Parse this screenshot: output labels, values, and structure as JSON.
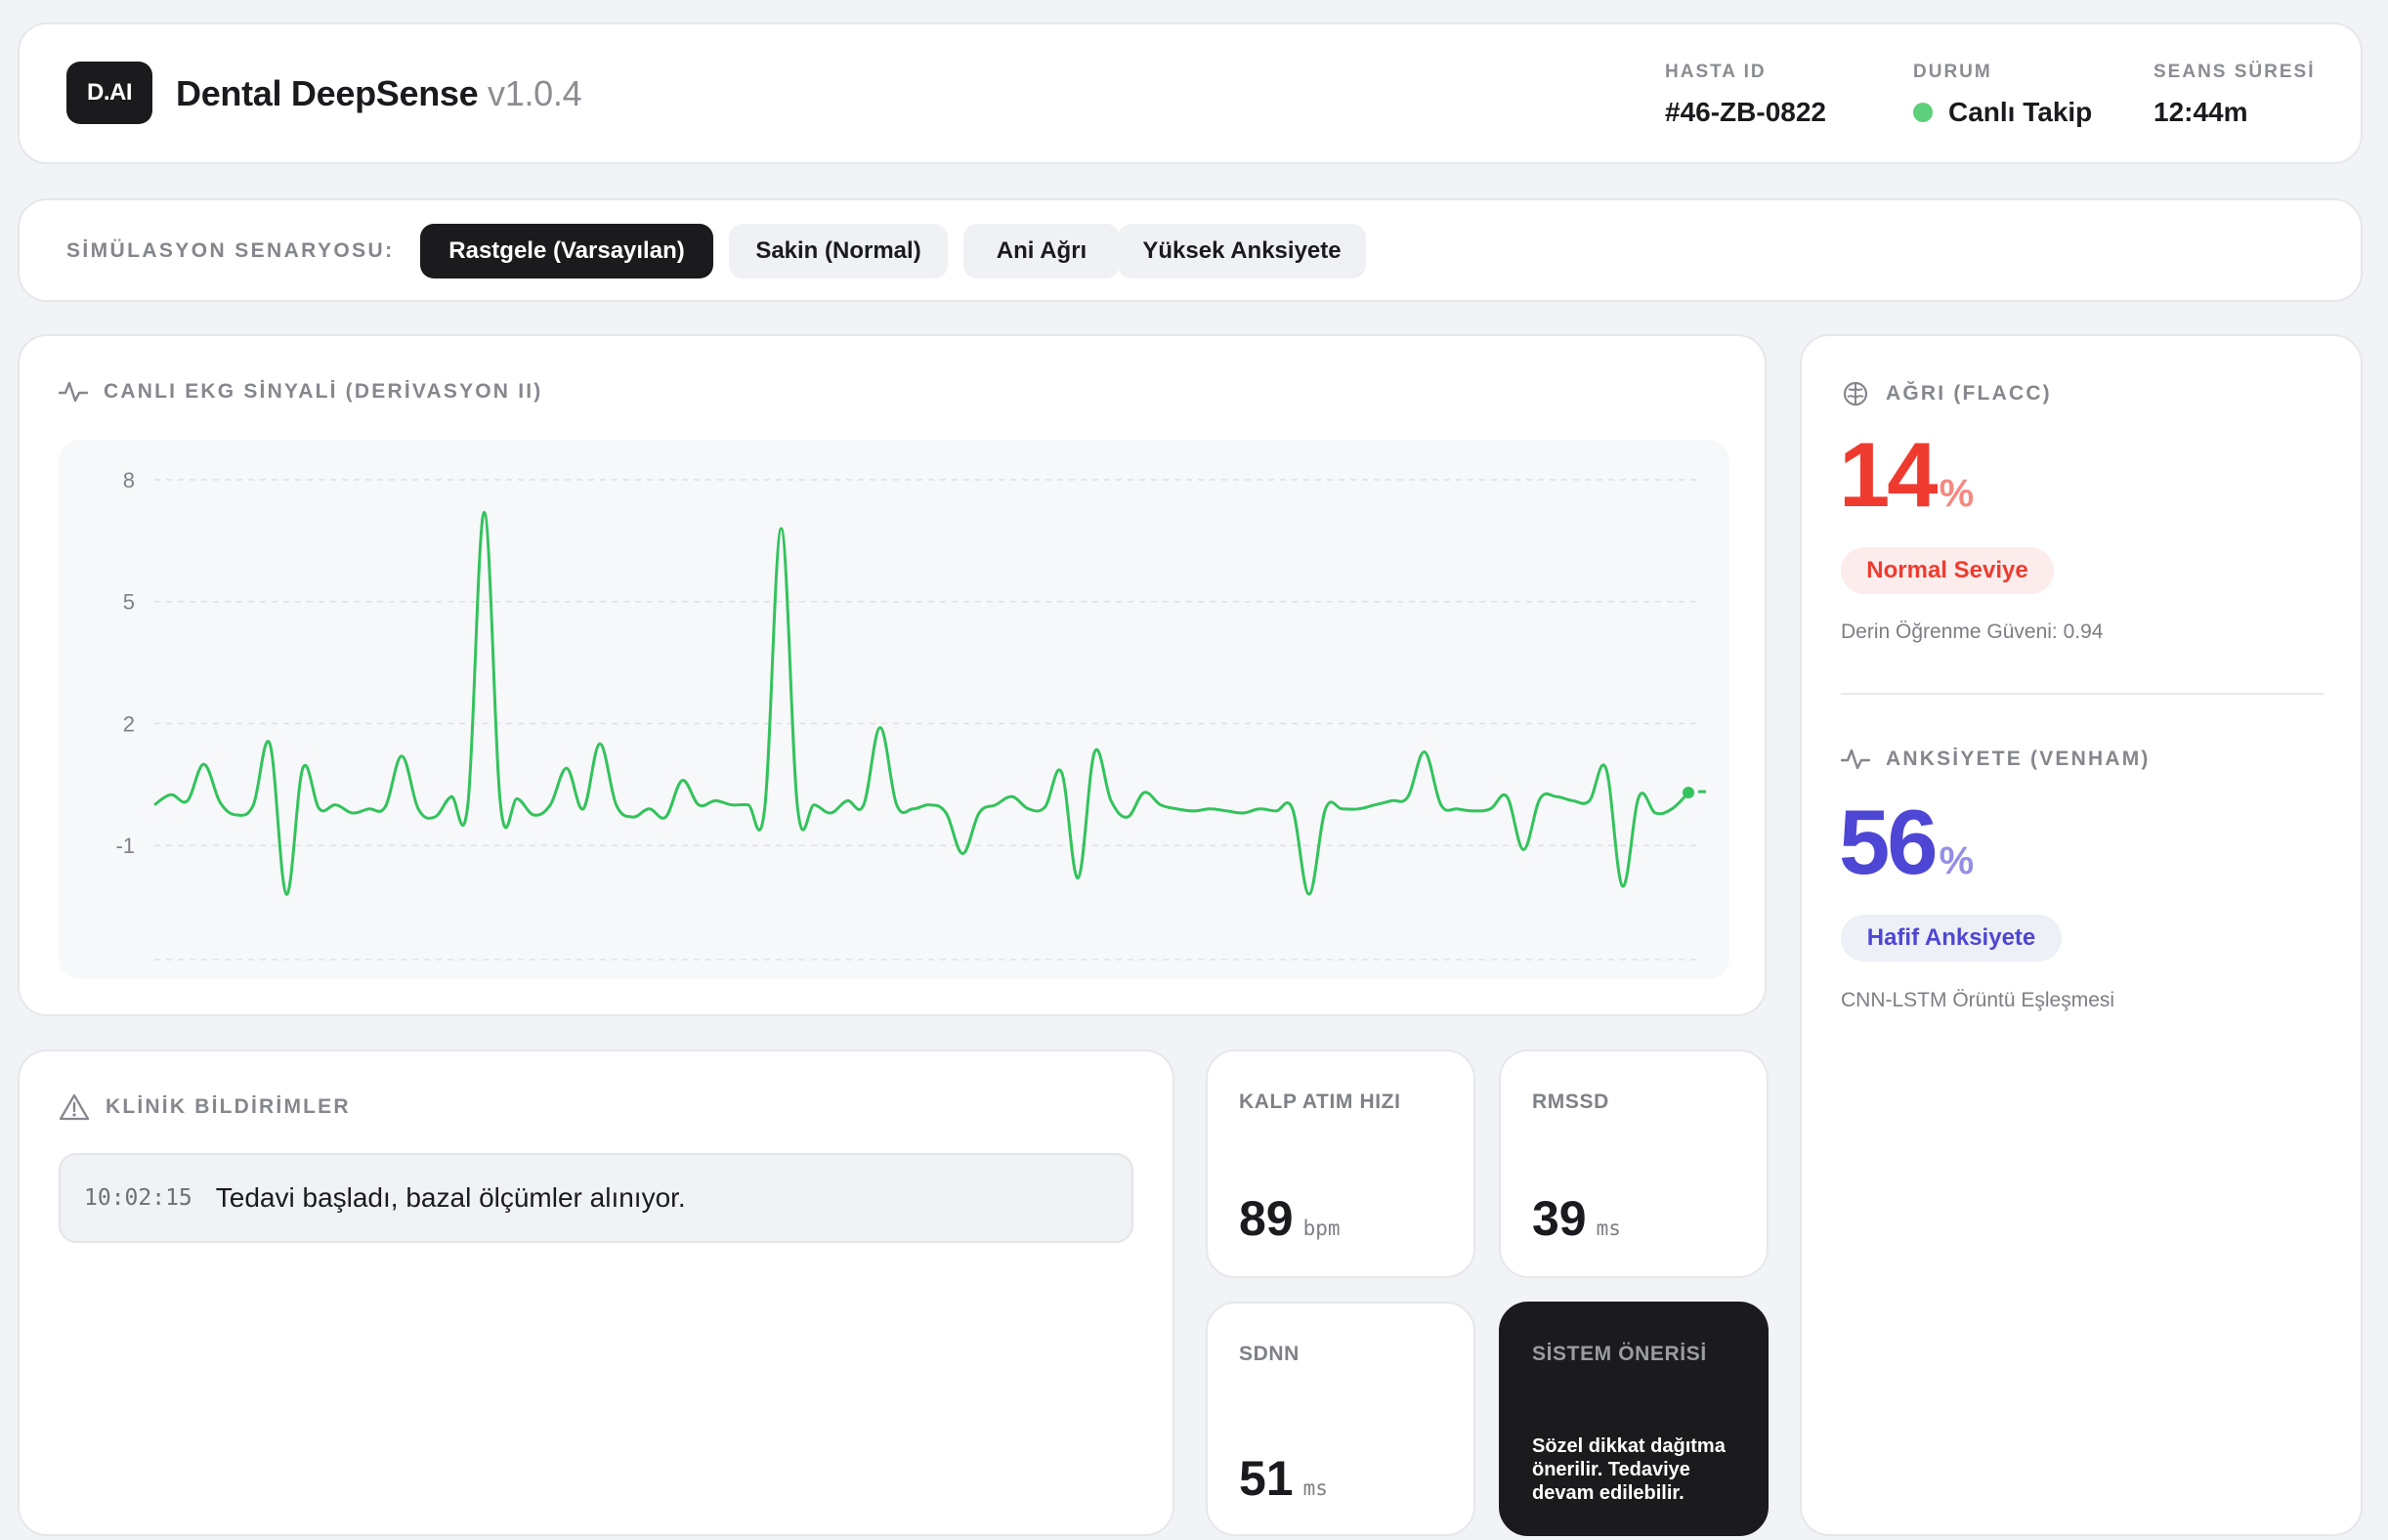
{
  "header": {
    "logo": "D.AI",
    "title": "Dental DeepSense",
    "version": "v1.0.4",
    "patient_id_label": "HASTA ID",
    "patient_id": "#46-ZB-0822",
    "status_label": "DURUM",
    "status": "Canlı Takip",
    "status_color": "#5cd07a",
    "session_label": "SEANS SÜRESİ",
    "session": "12:44m"
  },
  "scenario": {
    "label": "SİMÜLASYON SENARYOSU:",
    "options": [
      "Rastgele (Varsayılan)",
      "Sakin (Normal)",
      "Ani Ağrı",
      "Yüksek Anksiyete"
    ],
    "selected": "Rastgele (Varsayılan)"
  },
  "ecg": {
    "title": "CANLI EKG SİNYALİ (DERİVASYON II)",
    "icon": "pulse-icon"
  },
  "chart_data": {
    "type": "line",
    "title": "",
    "xlabel": "",
    "ylabel": "",
    "ylim": [
      -4,
      8.6
    ],
    "yticks": [
      -1,
      2,
      5,
      8
    ],
    "grid": true,
    "series": [
      {
        "color": "#33c35c",
        "values": [
          0,
          0.25,
          0.1,
          1,
          0.05,
          -0.25,
          0,
          1.5,
          -2.2,
          0.9,
          -0.1,
          0,
          -0.2,
          -0.1,
          -0.05,
          1.2,
          -0.1,
          -0.3,
          0.2,
          0,
          7.2,
          -0.05,
          0.15,
          -0.25,
          0,
          0.9,
          -0.1,
          1.5,
          0,
          -0.3,
          -0.1,
          -0.3,
          0.6,
          0,
          0.1,
          0,
          0,
          -0.1,
          6.8,
          -0.1,
          0,
          -0.2,
          0.1,
          0,
          1.9,
          0,
          -0.1,
          0,
          -0.2,
          -1.2,
          -0.2,
          0,
          0.2,
          -0.1,
          -0.05,
          0.8,
          -1.8,
          1.3,
          0.1,
          -0.3,
          0.3,
          0,
          -0.1,
          -0.15,
          -0.1,
          -0.15,
          -0.2,
          -0.1,
          -0.15,
          -0.1,
          -2.2,
          -0.1,
          -0.1,
          -0.1,
          0,
          0.1,
          0.2,
          1.3,
          0,
          -0.1,
          -0.15,
          -0.1,
          0.2,
          -1.1,
          0.15,
          0.2,
          0.1,
          0.1,
          0.9,
          -2,
          0.2,
          -0.2,
          -0.1,
          0.3
        ]
      }
    ]
  },
  "pain": {
    "title": "AĞRI (FLACC)",
    "icon": "brain-icon",
    "value": "14",
    "unit": "%",
    "level": "Normal Seviye",
    "confidence": "Derin Öğrenme Güveni: 0.94",
    "color": "#ef3b2f",
    "pill_bg": "#fdecec"
  },
  "anxiety": {
    "title": "ANKSİYETE (VENHAM)",
    "icon": "pulse-icon",
    "value": "56",
    "unit": "%",
    "level": "Hafif Anksiyete",
    "note": "CNN-LSTM Örüntü Eşleşmesi",
    "color": "#4e46d4",
    "pill_bg": "#eef0f7"
  },
  "alerts": {
    "title": "KLİNİK BİLDİRİMLER",
    "icon": "warning-icon",
    "items": [
      {
        "time": "10:02:15",
        "text": "Tedavi başladı, bazal ölçümler alınıyor."
      }
    ]
  },
  "metrics": {
    "heart_rate": {
      "label": "KALP ATIM HIZI",
      "value": "89",
      "unit": "bpm"
    },
    "rmssd": {
      "label": "RMSSD",
      "value": "39",
      "unit": "ms"
    },
    "sdnn": {
      "label": "SDNN",
      "value": "51",
      "unit": "ms"
    }
  },
  "recommendation": {
    "label": "SİSTEM ÖNERİSİ",
    "text": "Sözel dikkat dağıtma önerilir. Tedaviye devam edilebilir."
  }
}
